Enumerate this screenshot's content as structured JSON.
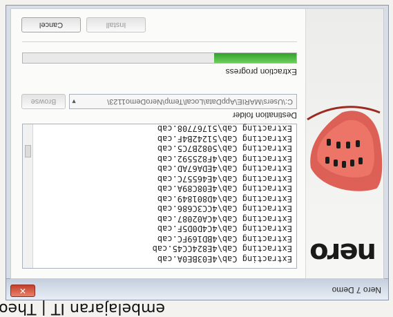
{
  "document_title": "embelajaran IT | Theory",
  "window": {
    "title": "Nero 7 Demo",
    "close_icon": "close-icon"
  },
  "banner": {
    "logo_text": "nero"
  },
  "log": {
    "lines": [
      "Extracting Cab\\4E03BE0A.cab",
      "Extracting Cab\\4E824CC45.cab",
      "Extracting Cab\\4BD169FC.cab",
      "Extracting Cab\\4C4D0D5F.cab",
      "Extracting Cab\\4CA02087.cab",
      "Extracting Cab\\4CC3C686.cab",
      "Extracting Cab\\4D801849.cab",
      "Extracting Cab\\4E08C89A.cab",
      "Extracting Cab\\4E46557C.cab",
      "Extracting Cab\\4EDA67AD.cab",
      "Extracting Cab\\4F825592.cab",
      "Extracting Cab\\5082B7C5.cab",
      "Extracting Cab\\51242B4F.cab",
      "Extracting Cab\\51767708.cab"
    ]
  },
  "destination": {
    "label": "Destination folder",
    "path": "C:\\Users\\MARIE\\AppData\\Local\\Temp\\NeroDemo1123\\",
    "browse_label": "Browse"
  },
  "progress": {
    "label": "Extraction progress",
    "value_percent": 30,
    "color": "#3fb332"
  },
  "buttons": {
    "install_label": "Install",
    "cancel_label": "Cancel"
  }
}
